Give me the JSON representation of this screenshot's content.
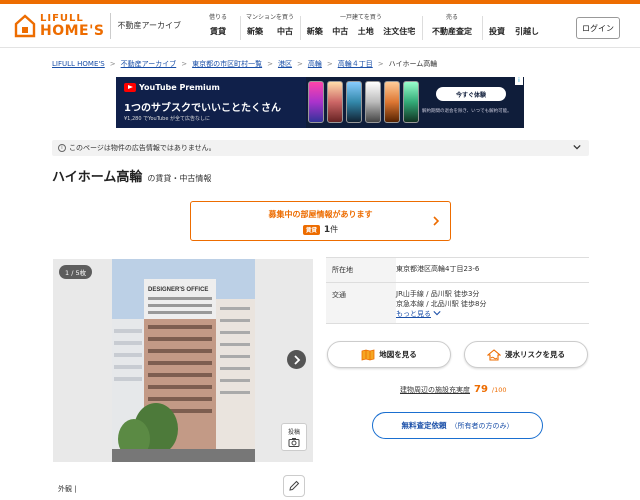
{
  "header": {
    "logo_top": "LIFULL",
    "logo_bottom": "HOME'S",
    "archive_label": "不動産アーカイブ",
    "nav_groups": [
      {
        "title": "借りる",
        "items": [
          "賃貸"
        ]
      },
      {
        "title": "マンションを買う",
        "items": [
          "新築",
          "中古"
        ]
      },
      {
        "title": "一戸建てを買う",
        "items": [
          "新築",
          "中古",
          "土地",
          "注文住宅"
        ]
      },
      {
        "title": "売る",
        "items": [
          "不動産査定"
        ]
      },
      {
        "title": "",
        "items": [
          "投資",
          "引越し"
        ]
      }
    ],
    "login_label": "ログイン"
  },
  "breadcrumb": [
    "LIFULL HOME'S",
    "不動産アーカイブ",
    "東京都の市区町村一覧",
    "港区",
    "高輪",
    "高輪４丁目",
    "ハイホーム高輪"
  ],
  "ad": {
    "brand": "YouTube Premium",
    "headline": "1つのサブスクでいいことたくさん",
    "sub": "¥1,280 でYouTube が全て広告なしに",
    "cta": "今すぐ体験",
    "fine": "解約期間の退会を除き、いつでも解約可能。",
    "info": "i"
  },
  "notice": {
    "text": "このページは物件の広告情報ではありません。"
  },
  "property": {
    "name": "ハイホーム高輪",
    "subtitle": "の賃貸・中古情報"
  },
  "recruit": {
    "title": "募集中の部屋情報があります",
    "badge": "賃貸",
    "count": "1",
    "count_unit": "件"
  },
  "photo": {
    "counter": "1 / 5枚",
    "post_label": "投稿",
    "caption": "外観 |",
    "sign_text": "DESIGNER'S OFFICE"
  },
  "info": {
    "address_label": "所在地",
    "address_value": "東京都港区高輪4丁目23-6",
    "access_label": "交通",
    "access_lines": [
      "JR山手線 / 品川駅 徒歩3分",
      "京急本線 / 北品川駅 徒歩8分"
    ],
    "more_label": "もっと見る"
  },
  "buttons": {
    "map": "地図を見る",
    "flood": "浸水リスクを見る"
  },
  "facility": {
    "label": "建物周辺の施設充実度",
    "score": "79",
    "denominator": "/100"
  },
  "assess": {
    "main": "無料査定依頼",
    "sub": "（所有者の方のみ）"
  },
  "colors": {
    "brand": "#ed6c00",
    "link": "#1a4fa8"
  }
}
